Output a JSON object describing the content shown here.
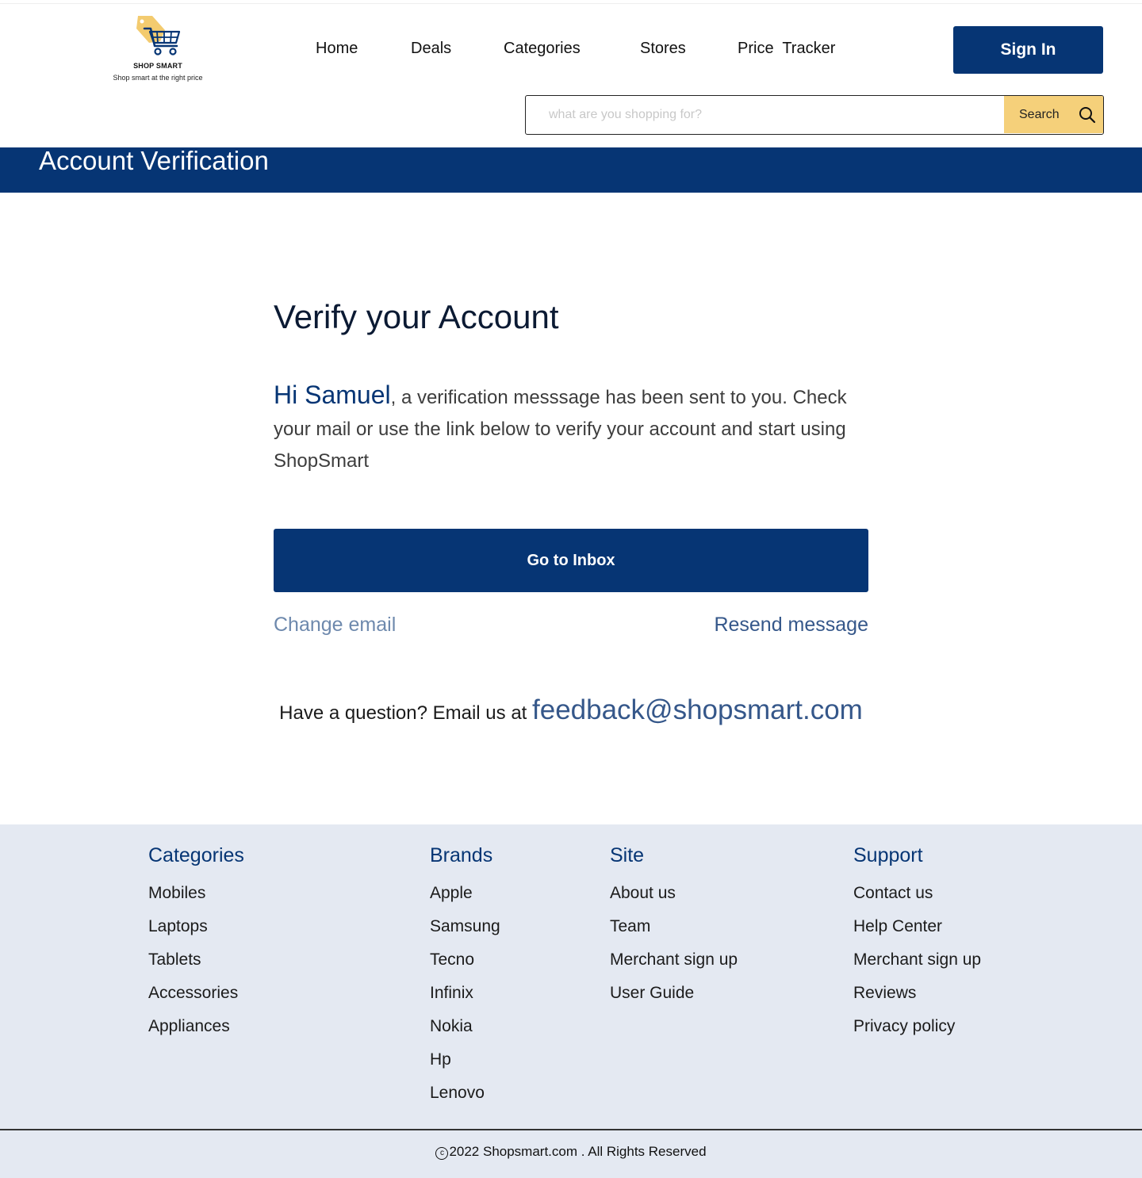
{
  "brand": {
    "name": "SHOP SMART",
    "tagline": "Shop smart at the right price",
    "logo_icon": "shopping-cart-tag-icon"
  },
  "nav": {
    "items": [
      "Home",
      "Deals",
      "Categories",
      "Stores",
      "Price  Tracker"
    ],
    "sign_in": "Sign In"
  },
  "search": {
    "placeholder": "what are you shopping for?",
    "value": "",
    "button_label": "Search",
    "icon": "search-icon"
  },
  "banner": {
    "title": "Account Verification"
  },
  "verify": {
    "heading": "Verify your Account",
    "greeting": "Hi Samuel",
    "message": ", a verification messsage has been sent to you. Check your mail or use the link below to verify your account and start using ShopSmart",
    "cta": "Go to Inbox",
    "change_email": "Change email",
    "resend": "Resend message"
  },
  "contact": {
    "text": "Have a question? Email us at ",
    "email": "feedback@shopsmart.com"
  },
  "footer": {
    "columns": [
      {
        "title": "Categories",
        "items": [
          "Mobiles",
          "Laptops",
          "Tablets",
          "Accessories",
          "Appliances"
        ]
      },
      {
        "title": "Brands",
        "items": [
          "Apple",
          "Samsung",
          "Tecno",
          "Infinix",
          "Nokia",
          "Hp",
          "Lenovo"
        ]
      },
      {
        "title": "Site",
        "items": [
          "About us",
          "Team",
          "Merchant sign up",
          "User Guide"
        ]
      },
      {
        "title": "Support",
        "items": [
          "Contact us",
          "Help Center",
          "Merchant sign up",
          "Reviews",
          "Privacy policy"
        ]
      }
    ],
    "copyright_symbol": "c",
    "copyright": "2022 Shopsmart.com . All Rights Reserved"
  },
  "colors": {
    "primary": "#063574",
    "accent": "#F5D07A",
    "link": "#35578A",
    "footer_bg": "#E4E9F2"
  }
}
